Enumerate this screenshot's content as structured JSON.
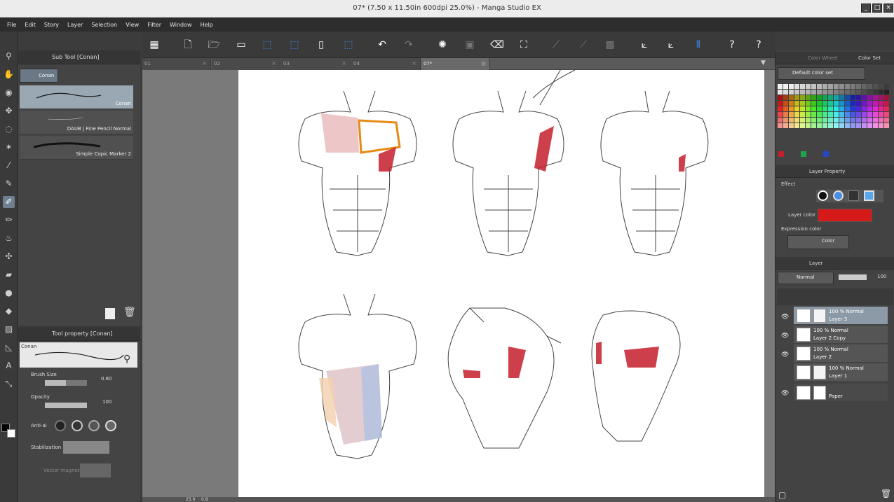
{
  "window": {
    "title": "07* (7.50 x 11.50in 600dpi 25.0%) - Manga Studio EX"
  },
  "menu": [
    "File",
    "Edit",
    "Story",
    "Layer",
    "Selection",
    "View",
    "Filter",
    "Window",
    "Help"
  ],
  "subtool": {
    "header": "Sub Tool [Conan]",
    "group_label": "Conan",
    "brushes": [
      {
        "name": "Conan",
        "selected": true
      },
      {
        "name": "DAUB | Fine Pencil Normal",
        "selected": false
      },
      {
        "name": "Simple Copic Marker 2",
        "selected": false
      }
    ]
  },
  "toolprop": {
    "header": "Tool property [Conan]",
    "preview_label": "Conan",
    "brush_size_label": "Brush Size",
    "brush_size_value": "0.80",
    "opacity_label": "Opacity",
    "opacity_value": "100",
    "antialias_label": "Anti-al",
    "stabilization_label": "Stabilization",
    "vector_magnet_label": "Vector magnet"
  },
  "tabs": [
    {
      "label": "01",
      "active": false
    },
    {
      "label": "02",
      "active": false
    },
    {
      "label": "03",
      "active": false
    },
    {
      "label": "04",
      "active": false
    },
    {
      "label": "07*",
      "active": true
    }
  ],
  "colorpanel": {
    "tab_wheel": "Color Wheel",
    "tab_set": "Color Set",
    "set_name": "Default color set"
  },
  "layerprop": {
    "header": "Layer Property",
    "effect_label": "Effect",
    "layer_color_label": "Layer color",
    "layer_color": "#d61a1a",
    "expression_label": "Expression color",
    "expression_value": "Color"
  },
  "layers": {
    "header": "Layer",
    "blend_mode": "Normal",
    "opacity": "100",
    "items": [
      {
        "opacity": "100 %",
        "mode": "Normal",
        "name": "Layer 3",
        "selected": true
      },
      {
        "opacity": "100 %",
        "mode": "Normal",
        "name": "Layer 2 Copy",
        "selected": false
      },
      {
        "opacity": "100 %",
        "mode": "Normal",
        "name": "Layer 2",
        "selected": false
      },
      {
        "opacity": "100 %",
        "mode": "Normal",
        "name": "Layer 1",
        "selected": false
      },
      {
        "opacity": "",
        "mode": "",
        "name": "Paper",
        "selected": false
      }
    ]
  },
  "status": {
    "zoom": "25.0 ",
    "unit": "0.8"
  }
}
